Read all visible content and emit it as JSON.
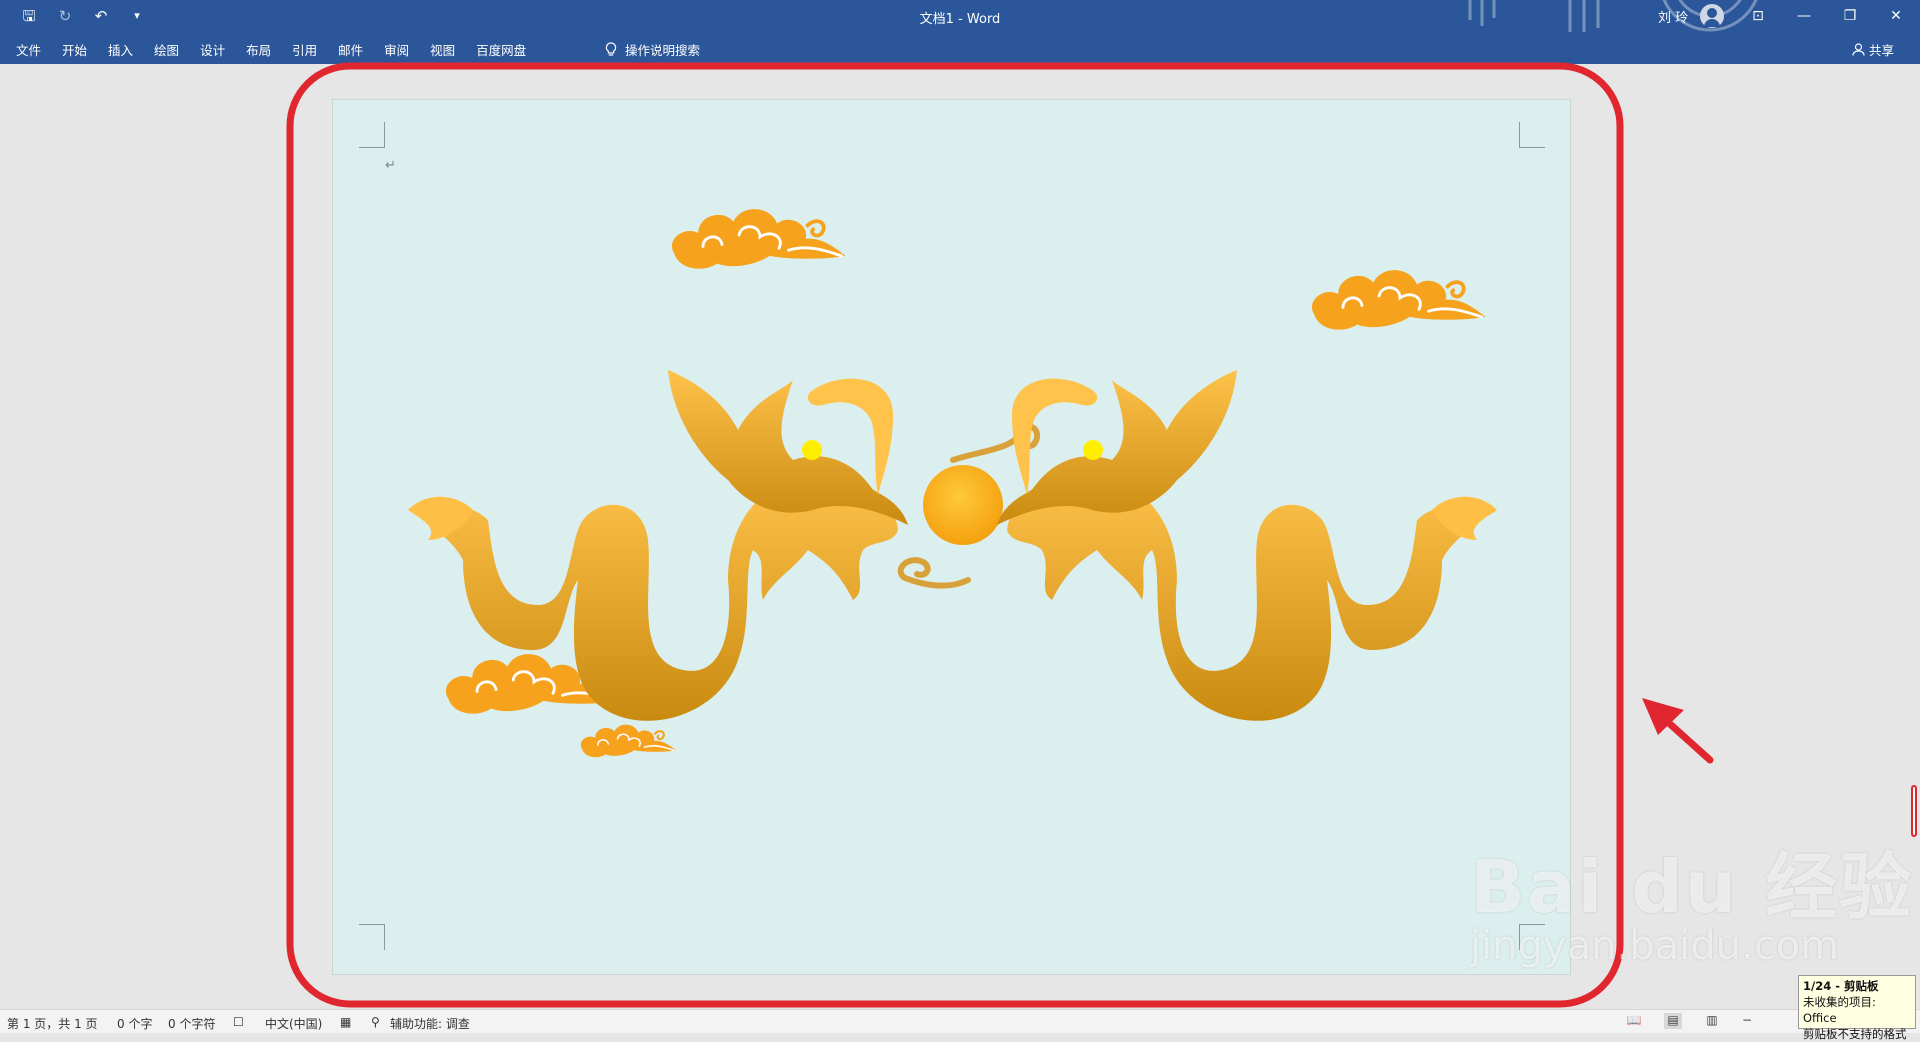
{
  "titlebar": {
    "doc_title": "文档1  -  Word",
    "user_name": "刘 玲",
    "qat_icons": [
      "save-icon",
      "autosave-icon",
      "undo-icon",
      "customize-icon"
    ],
    "window_buttons": {
      "ribbon_display": "⊡",
      "minimize": "—",
      "restore": "❐",
      "close": "✕"
    }
  },
  "ribbon": {
    "tabs": [
      "文件",
      "开始",
      "插入",
      "绘图",
      "设计",
      "布局",
      "引用",
      "邮件",
      "审阅",
      "视图",
      "百度网盘"
    ],
    "tell_me": "操作说明搜索",
    "share": "共享"
  },
  "document": {
    "paragraph_mark": "↵",
    "background_color": "#dbefee",
    "art_colors": {
      "dragon_top": "#ffc24a",
      "dragon_bottom": "#c98a10",
      "eye": "#ffee00",
      "pearl": "#ffb21a",
      "cloud": "#f6a21c"
    }
  },
  "annotation": {
    "color": "#e0262e"
  },
  "statusbar": {
    "page": "第 1 页，共 1 页",
    "words": "0 个字",
    "chars": "0 个字符",
    "language": "中文(中国)",
    "accessibility": "辅助功能: 调查"
  },
  "clipboard_tip": {
    "title": "1/24 - 剪贴板",
    "line1": "未收集的项目: Office",
    "line2": "剪贴板不支持的格式"
  },
  "watermark": {
    "line1": "Bai du 经验",
    "line2": "jingyan.baidu.com"
  }
}
